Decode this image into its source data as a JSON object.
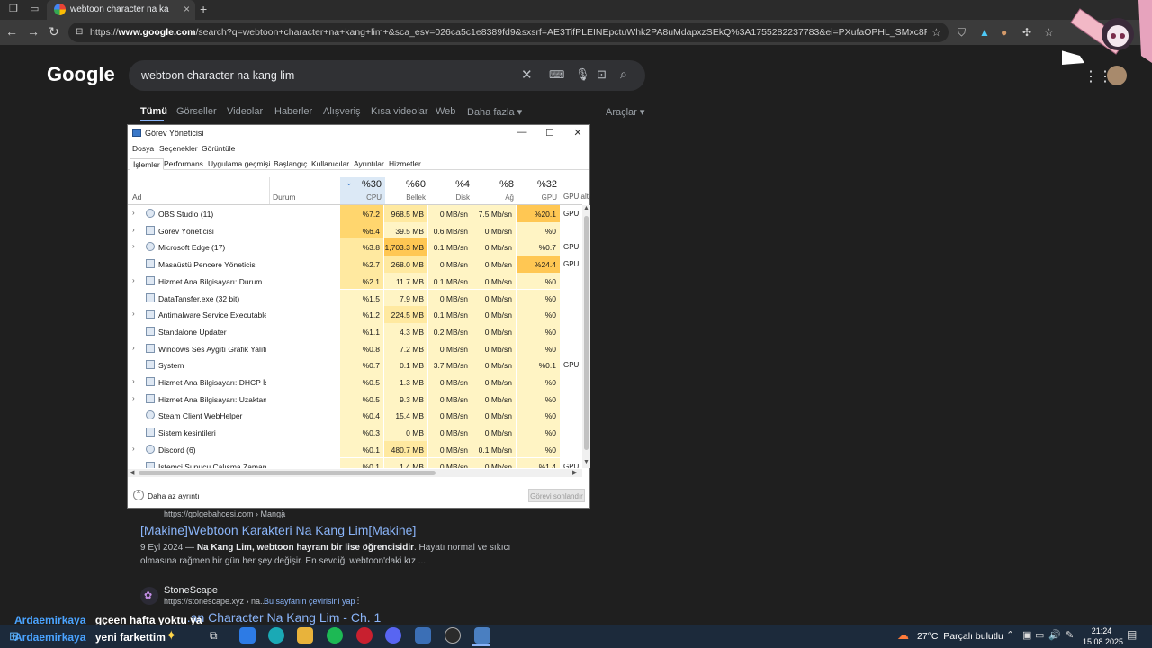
{
  "browser": {
    "tab_title": "webtoon character na kang lim",
    "url_prefix": "https://",
    "url_host": "www.google.com",
    "url_rest": "/search?q=webtoon+character+na+kang+lim+&sca_esv=026ca5c1e8389fd9&sxsrf=AE3TifPLEINEpctuWhk2PA8uMdapxzSEkQ%3A1755282237783&ei=PXufaOPHL_SMxc8P3evB8Aw&ved=0ahUKEwj..."
  },
  "google": {
    "logo": "Google",
    "query": "webtoon character na kang lim",
    "tabs": [
      "Tümü",
      "Görseller",
      "Videolar",
      "Haberler",
      "Alışveriş",
      "Kısa videolar",
      "Web",
      "Daha fazla"
    ],
    "tools": "Araçlar",
    "result1": {
      "url": "https://golgebahcesi.com › Manga",
      "title": "[Makine]Webtoon Karakteri Na Kang Lim[Makine]",
      "date": "9 Eyl 2024 —",
      "snippet_bold": "Na Kang Lim, webtoon hayranı bir lise öğrencisidir",
      "snippet_rest": ". Hayatı normal ve sıkıcı olmasına rağmen bir gün her şey değişir. En sevdiği webtoon'daki kız ..."
    },
    "result2": {
      "site": "StoneScape",
      "url": "https://stonescape.xyz › na...",
      "translate": "Bu sayfanın çevirisini yap",
      "title": "...an Character Na Kang Lim - Ch. 1"
    }
  },
  "task_manager": {
    "title": "Görev Yöneticisi",
    "menu": [
      "Dosya",
      "Seçenekler",
      "Görüntüle"
    ],
    "tabs": [
      "İşlemler",
      "Performans",
      "Uygulama geçmişi",
      "Başlangıç",
      "Kullanıcılar",
      "Ayrıntılar",
      "Hizmetler"
    ],
    "col_name": "Ad",
    "col_status": "Durum",
    "col_cpu_pct": "%30",
    "col_cpu": "CPU",
    "col_mem_pct": "%60",
    "col_mem": "Bellek",
    "col_disk_pct": "%4",
    "col_disk": "Disk",
    "col_net_pct": "%8",
    "col_net": "Ağ",
    "col_gpu_pct": "%32",
    "col_gpu": "GPU",
    "col_gpu_engine": "GPU alty",
    "rows": [
      {
        "name": "OBS Studio (11)",
        "cpu": "%7.2",
        "mem": "968.5 MB",
        "disk": "0 MB/sn",
        "net": "7.5 Mb/sn",
        "gpu": "%20.1",
        "eng": "GPU"
      },
      {
        "name": "Görev Yöneticisi",
        "cpu": "%6.4",
        "mem": "39.5 MB",
        "disk": "0.6 MB/sn",
        "net": "0 Mb/sn",
        "gpu": "%0",
        "eng": ""
      },
      {
        "name": "Microsoft Edge (17)",
        "cpu": "%3.8",
        "mem": "1,703.3 MB",
        "disk": "0.1 MB/sn",
        "net": "0 Mb/sn",
        "gpu": "%0.7",
        "eng": "GPU"
      },
      {
        "name": "Masaüstü Pencere Yöneticisi",
        "cpu": "%2.7",
        "mem": "268.0 MB",
        "disk": "0 MB/sn",
        "net": "0 Mb/sn",
        "gpu": "%24.4",
        "eng": "GPU"
      },
      {
        "name": "Hizmet Ana Bilgisayarı: Durum ...",
        "cpu": "%2.1",
        "mem": "11.7 MB",
        "disk": "0.1 MB/sn",
        "net": "0 Mb/sn",
        "gpu": "%0",
        "eng": ""
      },
      {
        "name": "DataTansfer.exe (32 bit)",
        "cpu": "%1.5",
        "mem": "7.9 MB",
        "disk": "0 MB/sn",
        "net": "0 Mb/sn",
        "gpu": "%0",
        "eng": ""
      },
      {
        "name": "Antimalware Service Executable",
        "cpu": "%1.2",
        "mem": "224.5 MB",
        "disk": "0.1 MB/sn",
        "net": "0 Mb/sn",
        "gpu": "%0",
        "eng": ""
      },
      {
        "name": "Standalone Updater",
        "cpu": "%1.1",
        "mem": "4.3 MB",
        "disk": "0.2 MB/sn",
        "net": "0 Mb/sn",
        "gpu": "%0",
        "eng": ""
      },
      {
        "name": "Windows Ses Aygıtı Grafik Yalıtı...",
        "cpu": "%0.8",
        "mem": "7.2 MB",
        "disk": "0 MB/sn",
        "net": "0 Mb/sn",
        "gpu": "%0",
        "eng": ""
      },
      {
        "name": "System",
        "cpu": "%0.7",
        "mem": "0.1 MB",
        "disk": "3.7 MB/sn",
        "net": "0 Mb/sn",
        "gpu": "%0.1",
        "eng": "GPU"
      },
      {
        "name": "Hizmet Ana Bilgisayarı: DHCP İs...",
        "cpu": "%0.5",
        "mem": "1.3 MB",
        "disk": "0 MB/sn",
        "net": "0 Mb/sn",
        "gpu": "%0",
        "eng": ""
      },
      {
        "name": "Hizmet Ana Bilgisayarı: Uzaktan ...",
        "cpu": "%0.5",
        "mem": "9.3 MB",
        "disk": "0 MB/sn",
        "net": "0 Mb/sn",
        "gpu": "%0",
        "eng": ""
      },
      {
        "name": "Steam Client WebHelper",
        "cpu": "%0.4",
        "mem": "15.4 MB",
        "disk": "0 MB/sn",
        "net": "0 Mb/sn",
        "gpu": "%0",
        "eng": ""
      },
      {
        "name": "Sistem kesintileri",
        "cpu": "%0.3",
        "mem": "0 MB",
        "disk": "0 MB/sn",
        "net": "0 Mb/sn",
        "gpu": "%0",
        "eng": ""
      },
      {
        "name": "Discord (6)",
        "cpu": "%0.1",
        "mem": "480.7 MB",
        "disk": "0 MB/sn",
        "net": "0.1 Mb/sn",
        "gpu": "%0",
        "eng": ""
      },
      {
        "name": "İstemci Sunucu Çalışma Zamanı...",
        "cpu": "%0.1",
        "mem": "1.4 MB",
        "disk": "0 MB/sn",
        "net": "0 Mb/sn",
        "gpu": "%1.4",
        "eng": "GPU"
      }
    ],
    "less_details": "Daha az ayrıntı",
    "end_task": "Görevi sonlandır"
  },
  "overlay": {
    "user1": "Ardaemirkaya",
    "msg1": "gçeen hafta yoktu ya",
    "user2": "Ardaemirkaya",
    "msg2": "yeni farkettim"
  },
  "taskbar": {
    "weather": "27°C  Parçalı bulutlu",
    "time": "21:24",
    "date": "15.08.2025"
  }
}
